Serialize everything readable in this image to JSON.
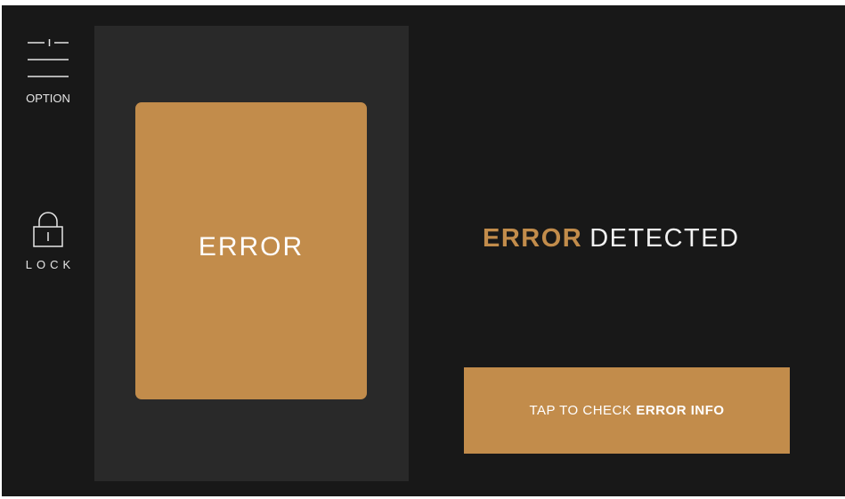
{
  "sidebar": {
    "option_label": "OPTION",
    "option_icon": "sliders-icon",
    "lock_label": "LOCK",
    "lock_icon": "lock-icon"
  },
  "panel": {
    "card_label": "ERROR"
  },
  "status": {
    "highlight": "ERROR",
    "rest": "DETECTED"
  },
  "action": {
    "prefix": "TAP TO CHECK",
    "highlight": "ERROR INFO"
  },
  "colors": {
    "background": "#181818",
    "panel": "#292929",
    "accent": "#c28c4b",
    "text": "#f2f2f2"
  }
}
